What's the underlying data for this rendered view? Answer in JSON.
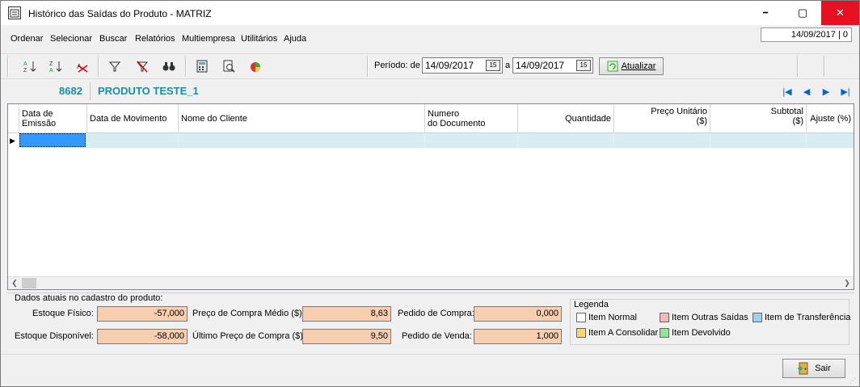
{
  "window": {
    "title": "Histórico das Saídas do Produto - MATRIZ",
    "minimize_glyph": "━",
    "maximize_glyph": "▢",
    "close_glyph": "✕"
  },
  "menu": [
    {
      "label": "Ordenar"
    },
    {
      "label": "Selecionar"
    },
    {
      "label": "Buscar"
    },
    {
      "label": "Relatórios"
    },
    {
      "label": "Multiempresa"
    },
    {
      "label": "Utilitários"
    },
    {
      "label": "Ajuda"
    }
  ],
  "status_date": "14/09/2017 | 0",
  "toolbar": {
    "icons": [
      "sort-asc-icon",
      "sort-desc-icon",
      "clear-sort-icon",
      "filter-icon",
      "clear-filter-icon",
      "binoculars-icon",
      "calculator-icon",
      "print-preview-icon",
      "chart-icon"
    ],
    "period_label": "Período: de",
    "date_from": "14/09/2017",
    "to_label": "a",
    "date_to": "14/09/2017",
    "calendar_glyph": "15",
    "refresh_label": "Atualizar"
  },
  "product": {
    "code": "8682",
    "name": "PRODUTO TESTE_1",
    "nav_first": "|◀",
    "nav_prev": "◀",
    "nav_next": "▶",
    "nav_last": "▶|"
  },
  "grid": {
    "columns": [
      {
        "label": "Data de Emissão"
      },
      {
        "label": "Data de Movimento"
      },
      {
        "label": "Nome do Cliente"
      },
      {
        "label": "Numero\ndo Documento"
      },
      {
        "label": "Quantidade"
      },
      {
        "label": "Preço Unitário\n($)"
      },
      {
        "label": "Subtotal\n($)"
      },
      {
        "label": "Ajuste (%)"
      }
    ],
    "row_indicator": "▶"
  },
  "summary": {
    "caption": "Dados atuais no cadastro do produto:",
    "estoque_fisico_label": "Estoque Físico:",
    "estoque_fisico": "-57,000",
    "estoque_disponivel_label": "Estoque Disponível:",
    "estoque_disponivel": "-58,000",
    "preco_medio_label": "Preço de Compra Médio ($):",
    "preco_medio": "8,63",
    "ultimo_preco_label": "Último Preço de Compra ($):",
    "ultimo_preco": "9,50",
    "pedido_compra_label": "Pedido de Compra:",
    "pedido_compra": "0,000",
    "pedido_venda_label": "Pedido de Venda:",
    "pedido_venda": "1,000"
  },
  "legend": {
    "title": "Legenda",
    "items": [
      {
        "label": "Item Normal",
        "color": "#ffffff"
      },
      {
        "label": "Item Outras Saídas",
        "color": "#f4b8b8"
      },
      {
        "label": "Item de Transferência",
        "color": "#9fd0ea"
      },
      {
        "label": "Item A Consolidar",
        "color": "#f5d77a"
      },
      {
        "label": "Item Devolvido",
        "color": "#8fe39a"
      }
    ]
  },
  "exit_label": "Sair",
  "colors": {
    "accent": "#1a8fa3",
    "selected_row": "#d6eef2",
    "readonly_field": "#f7cfb0",
    "close_button": "#e81123"
  }
}
